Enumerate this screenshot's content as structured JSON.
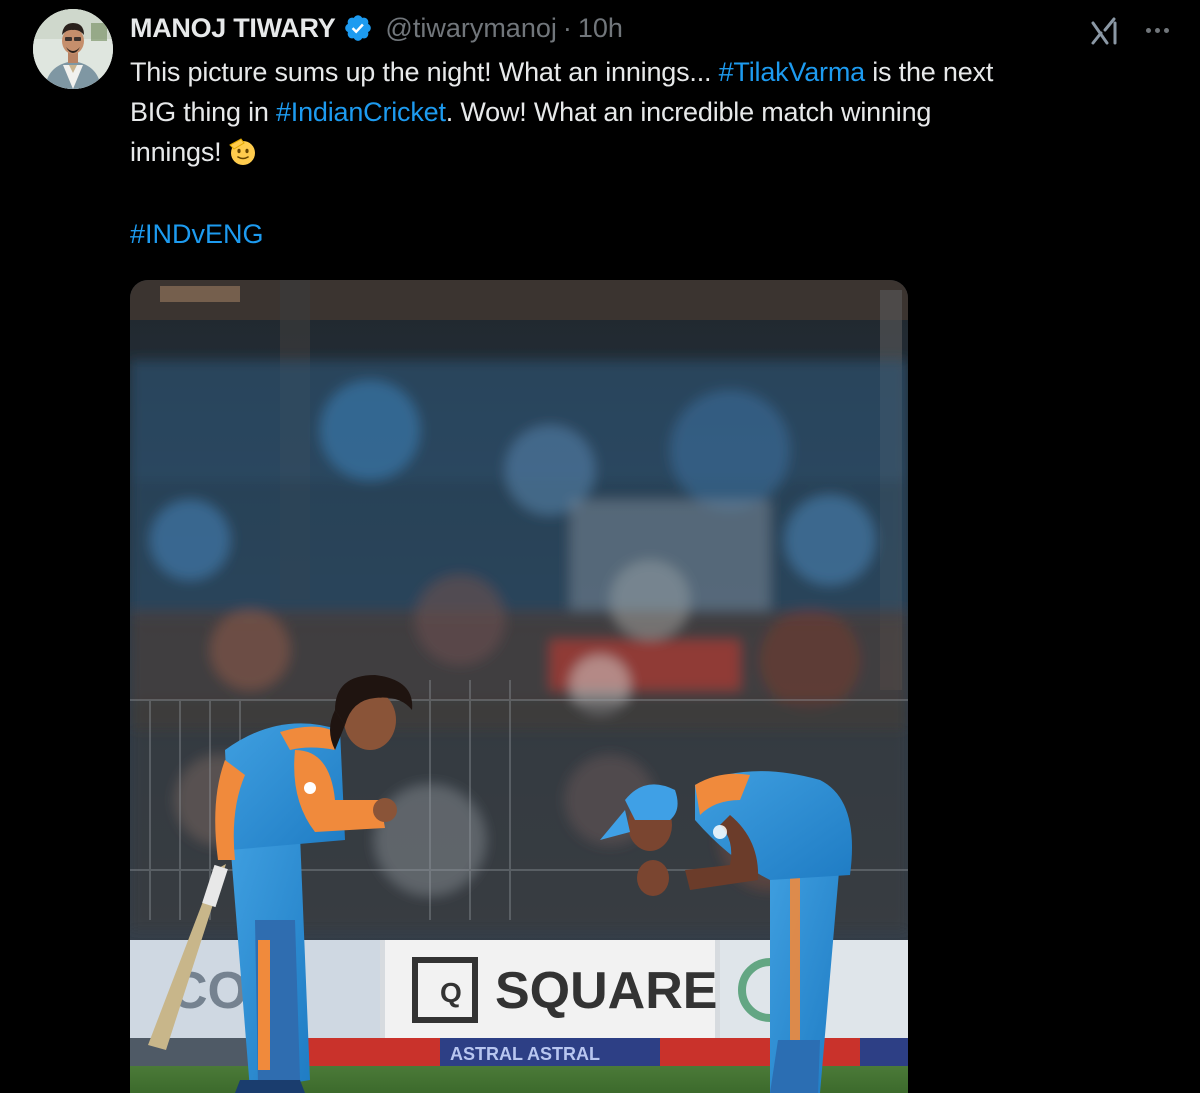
{
  "author": {
    "name": "MANOJ TIWARY",
    "handle": "@tiwarymanoj",
    "separator": "·",
    "time": "10h",
    "verified": true,
    "avatar_icon": "profile-photo"
  },
  "actions": {
    "grok_icon": "grok-icon",
    "more_icon": "more-options-icon"
  },
  "tweet": {
    "line1_a": "This picture sums up the night! What an innings... ",
    "line1_tag": "#TilakVarma",
    "line1_b": " is the next",
    "line2_a": "BIG thing in ",
    "line2_tag": "#IndianCricket",
    "line2_b": ". Wow! What an incredible match winning",
    "line3_a": "innings!",
    "emoji": "saluting-face-emoji",
    "hashtag_footer": "#INDvENG"
  },
  "media": {
    "type": "photo",
    "banner_text": "SQUARE",
    "banner_text_2": "ASTRAL  ASTRAL"
  },
  "colors": {
    "background": "#000000",
    "text": "#e7e9ea",
    "muted": "#71767b",
    "link": "#1d9bf0",
    "verified": "#1d9bf0"
  }
}
